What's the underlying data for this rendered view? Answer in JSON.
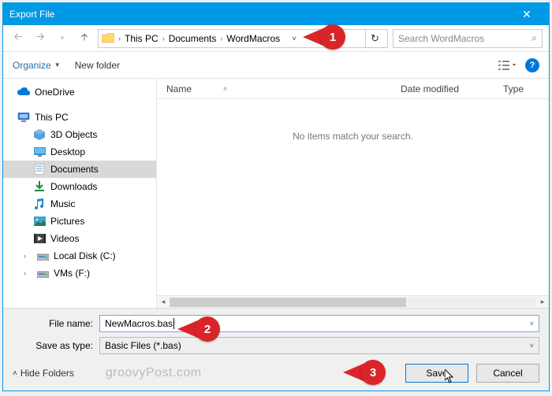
{
  "window": {
    "title": "Export File"
  },
  "breadcrumb": {
    "pc": "This PC",
    "docs": "Documents",
    "folder": "WordMacros"
  },
  "search": {
    "placeholder": "Search WordMacros"
  },
  "toolbar": {
    "organize": "Organize",
    "newfolder": "New folder"
  },
  "tree": {
    "onedrive": "OneDrive",
    "thispc": "This PC",
    "objects3d": "3D Objects",
    "desktop": "Desktop",
    "documents": "Documents",
    "downloads": "Downloads",
    "music": "Music",
    "pictures": "Pictures",
    "videos": "Videos",
    "localdisk": "Local Disk (C:)",
    "vms": "VMs (F:)"
  },
  "columns": {
    "name": "Name",
    "date": "Date modified",
    "type": "Type"
  },
  "emptymsg": "No items match your search.",
  "fields": {
    "filename_label": "File name:",
    "filename_value": "NewMacros.bas",
    "saveas_label": "Save as type:",
    "saveas_value": "Basic Files (*.bas)"
  },
  "buttons": {
    "hidefolders": "Hide Folders",
    "save": "Save",
    "cancel": "Cancel"
  },
  "watermark": "groovyPost.com",
  "callouts": {
    "one": "1",
    "two": "2",
    "three": "3"
  }
}
